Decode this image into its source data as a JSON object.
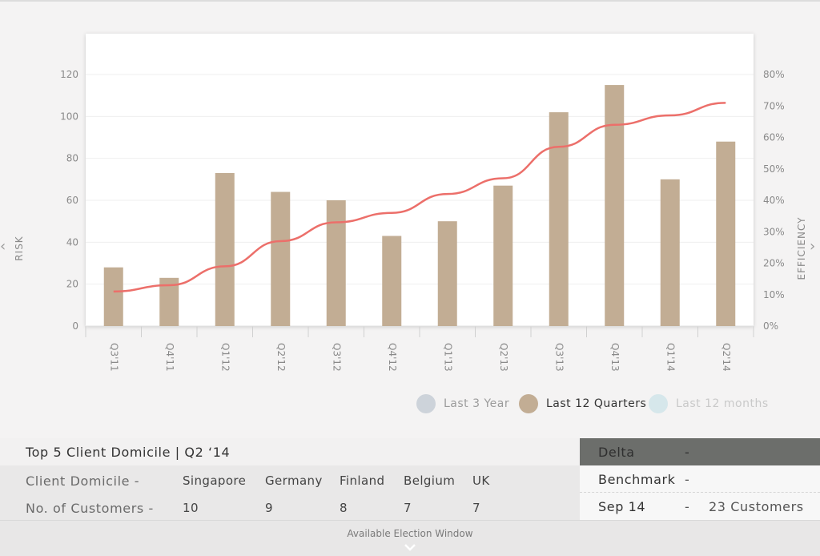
{
  "nav": {
    "left_glyph": "‹",
    "right_glyph": "›"
  },
  "chart_data": {
    "type": "bar",
    "categories": [
      "Q3'11",
      "Q4'11",
      "Q1'12",
      "Q2'12",
      "Q3'12",
      "Q4'12",
      "Q1'13",
      "Q2'13",
      "Q3'13",
      "Q4'13",
      "Q1'14",
      "Q2'14"
    ],
    "series": [
      {
        "type": "bar",
        "axis": "left",
        "color": "#c2ad94",
        "values": [
          28,
          23,
          73,
          64,
          60,
          43,
          50,
          67,
          102,
          115,
          70,
          88
        ]
      },
      {
        "type": "line",
        "axis": "right",
        "color": "#ec6f6a",
        "values": [
          11,
          13,
          19,
          27,
          33,
          36,
          42,
          47,
          57,
          64,
          67,
          71
        ]
      }
    ],
    "ylabel": "RISK",
    "y2label": "EFFICIENCY",
    "ylim": [
      0,
      120
    ],
    "y2lim": [
      0,
      80
    ],
    "yticks": [
      0,
      20,
      40,
      60,
      80,
      100,
      120
    ],
    "y2ticks": [
      "0%",
      "10%",
      "20%",
      "30%",
      "40%",
      "50%",
      "60%",
      "70%",
      "80%"
    ],
    "grid": true
  },
  "legend": [
    {
      "label": "Last 3 Year",
      "color": "#cdd3da"
    },
    {
      "label": "Last 12 Quarters",
      "color": "#c2ad94"
    },
    {
      "label": "Last 12 months",
      "color": "#d6e7eb"
    }
  ],
  "domicile": {
    "title": "Top 5 Client Domicile | Q2 ‘14",
    "row1_label": "Client Domicile -",
    "row2_label": "No. of Customers -",
    "countries": [
      "Singapore",
      "Germany",
      "Finland",
      "Belgium",
      "UK"
    ],
    "customers": [
      "10",
      "9",
      "8",
      "7",
      "7"
    ]
  },
  "summary": {
    "delta_label": "Delta",
    "delta_value": "-",
    "benchmark_label": "Benchmark",
    "benchmark_value": "-",
    "date_label": "Sep 14",
    "date_dash": "-",
    "date_value": "23 Customers"
  },
  "footer": {
    "label": "Available Election Window"
  }
}
